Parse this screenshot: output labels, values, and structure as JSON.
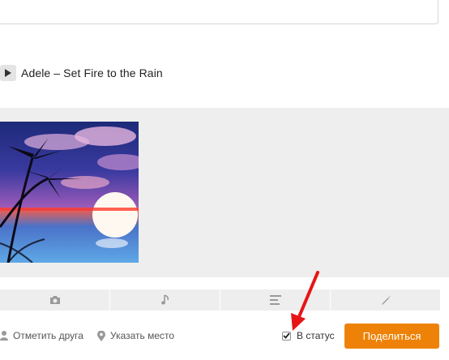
{
  "track": {
    "title": "Adele – Set Fire to the Rain",
    "icon": "play-icon"
  },
  "attach_toolbar": {
    "buttons": [
      {
        "icon": "camera-icon"
      },
      {
        "icon": "music-note-icon"
      },
      {
        "icon": "text-lines-icon"
      },
      {
        "icon": "pencil-icon"
      }
    ]
  },
  "actions": {
    "tag_friend_label": "Отметить друга",
    "tag_place_label": "Указать место",
    "status_checkbox_label": "В статус",
    "status_checked": true,
    "share_button_label": "Поделиться"
  },
  "colors": {
    "accent": "#ee8208",
    "panel": "#eeeeee",
    "annotation_arrow": "#e61616"
  }
}
